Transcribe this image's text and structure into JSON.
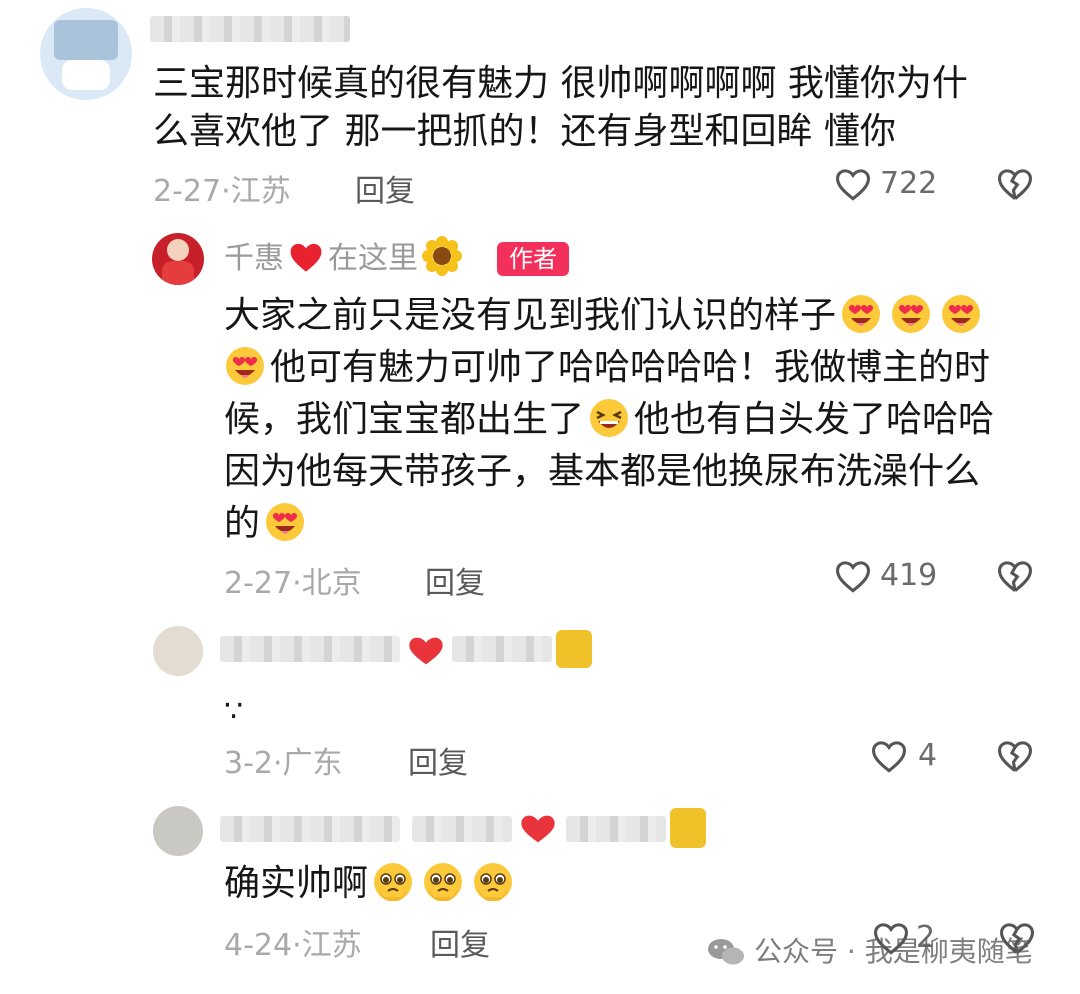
{
  "comments": [
    {
      "text_lines": [
        "三宝那时候真的很有魅力 很帅啊啊啊啊 我懂你为什",
        "么喜欢他了 那一把抓的！还有身型和回眸 懂你"
      ],
      "meta": "2-27·江苏",
      "reply_label": "回复",
      "likes": "722"
    },
    {
      "author": "千惠",
      "author_suffix": "在这里",
      "badge": "作者",
      "text_lines": [
        "大家之前只是没有见到我们认识的样子",
        "他可有魅力可帅了哈哈哈哈哈！我做博主的时",
        "候，我们宝宝都出生了",
        "他也有白头发了哈哈哈",
        "因为他每天带孩子，基本都是他换尿布洗澡什么",
        "的"
      ],
      "meta": "2-27·北京",
      "reply_label": "回复",
      "likes": "419"
    },
    {
      "text": "∵",
      "meta": "3-2·广东",
      "reply_label": "回复",
      "likes": "4"
    },
    {
      "text": "确实帅啊",
      "meta": "4-24·江苏",
      "reply_label": "回复",
      "likes": "2"
    }
  ],
  "watermark": "公众号 · 我是柳夷随笔",
  "colors": {
    "badge_bg": "#f2305b",
    "text": "#161616",
    "meta": "#a9a9a9"
  }
}
